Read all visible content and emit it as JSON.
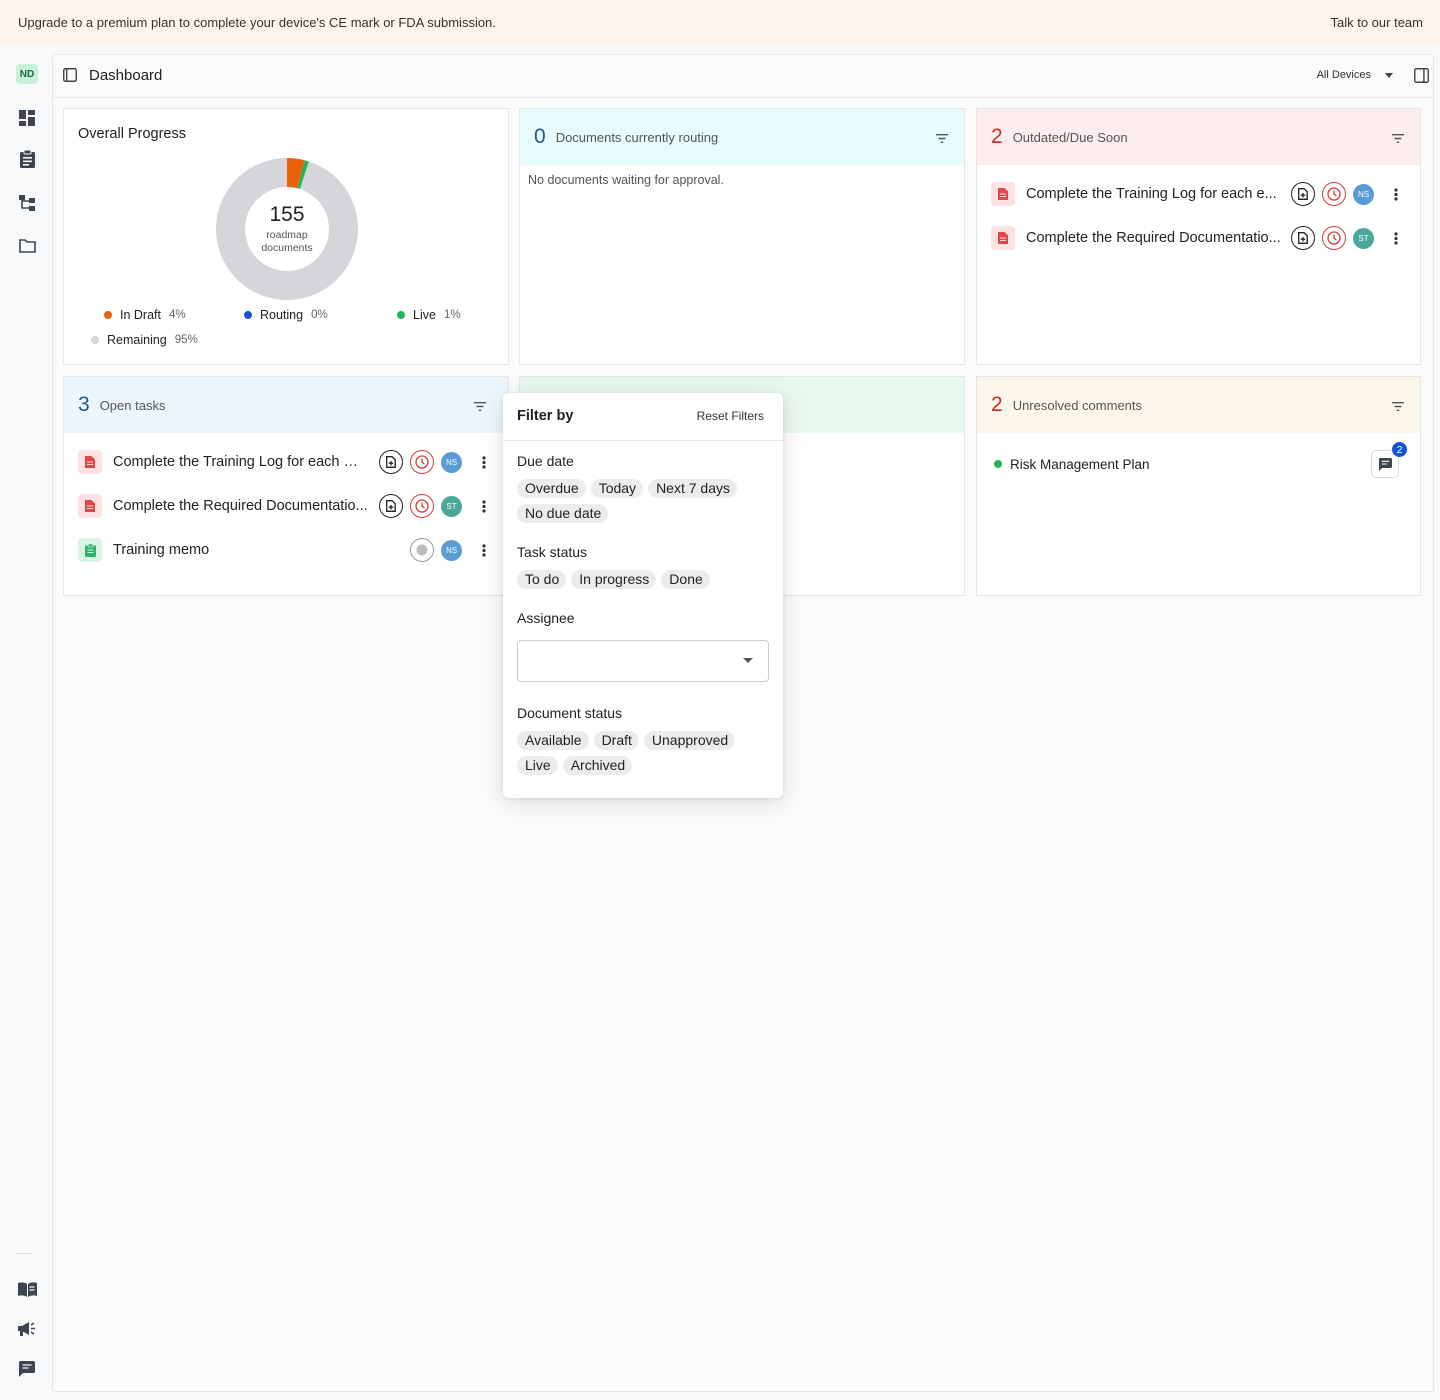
{
  "banner": {
    "message": "Upgrade to a premium plan to complete your device's CE mark or FDA submission.",
    "cta": "Talk to our team"
  },
  "rail": {
    "avatar": "ND",
    "icons": [
      "dashboard-icon",
      "clipboard-icon",
      "hierarchy-icon",
      "folder-icon",
      "book-icon",
      "megaphone-icon",
      "chat-icon"
    ]
  },
  "topbar": {
    "title": "Dashboard",
    "device_select": "All Devices"
  },
  "progress": {
    "title": "Overall Progress",
    "total": "155",
    "caption_line1": "roadmap",
    "caption_line2": "documents",
    "legend": [
      {
        "label": "In Draft",
        "pct": "4%",
        "color": "#e8620c"
      },
      {
        "label": "Routing",
        "pct": "0%",
        "color": "#1553d6"
      },
      {
        "label": "Live",
        "pct": "1%",
        "color": "#22b45a"
      },
      {
        "label": "Remaining",
        "pct": "95%",
        "color": "#d4d6d9"
      }
    ]
  },
  "routing": {
    "count": "0",
    "label": "Documents currently routing",
    "empty": "No documents waiting for approval."
  },
  "outdated": {
    "count": "2",
    "label": "Outdated/Due Soon",
    "rows": [
      {
        "text": "Complete the Training Log for each e...",
        "avatar": "NS"
      },
      {
        "text": "Complete the Required Documentatio...",
        "avatar": "ST"
      }
    ]
  },
  "tasks": {
    "count": "3",
    "label": "Open tasks",
    "rows": [
      {
        "text": "Complete the Training Log for each e...",
        "avatar": "NS"
      },
      {
        "text": "Complete the Required Documentatio...",
        "avatar": "ST"
      },
      {
        "text": "Training memo",
        "avatar": "NS"
      }
    ]
  },
  "comments": {
    "count": "2",
    "label": "Unresolved comments",
    "rows": [
      {
        "text": "Risk Management Plan",
        "badge": "2"
      }
    ]
  },
  "filter": {
    "title": "Filter by",
    "reset": "Reset Filters",
    "due_date": {
      "label": "Due date",
      "options": [
        "Overdue",
        "Today",
        "Next 7 days",
        "No due date"
      ]
    },
    "task_status": {
      "label": "Task status",
      "options": [
        "To do",
        "In progress",
        "Done"
      ]
    },
    "assignee": {
      "label": "Assignee",
      "value": ""
    },
    "document_status": {
      "label": "Document status",
      "options": [
        "Available",
        "Draft",
        "Unapproved",
        "Live",
        "Archived"
      ]
    }
  },
  "colors": {
    "routing_bg": "#e8fbfd",
    "outdated_bg": "#fdeeee",
    "tasks_bg": "#eef6fd",
    "green_bg": "#e8faf0",
    "comments_bg": "#fdf6ea",
    "count_blue": "#1a5a8c",
    "count_red": "#c92a2a"
  }
}
